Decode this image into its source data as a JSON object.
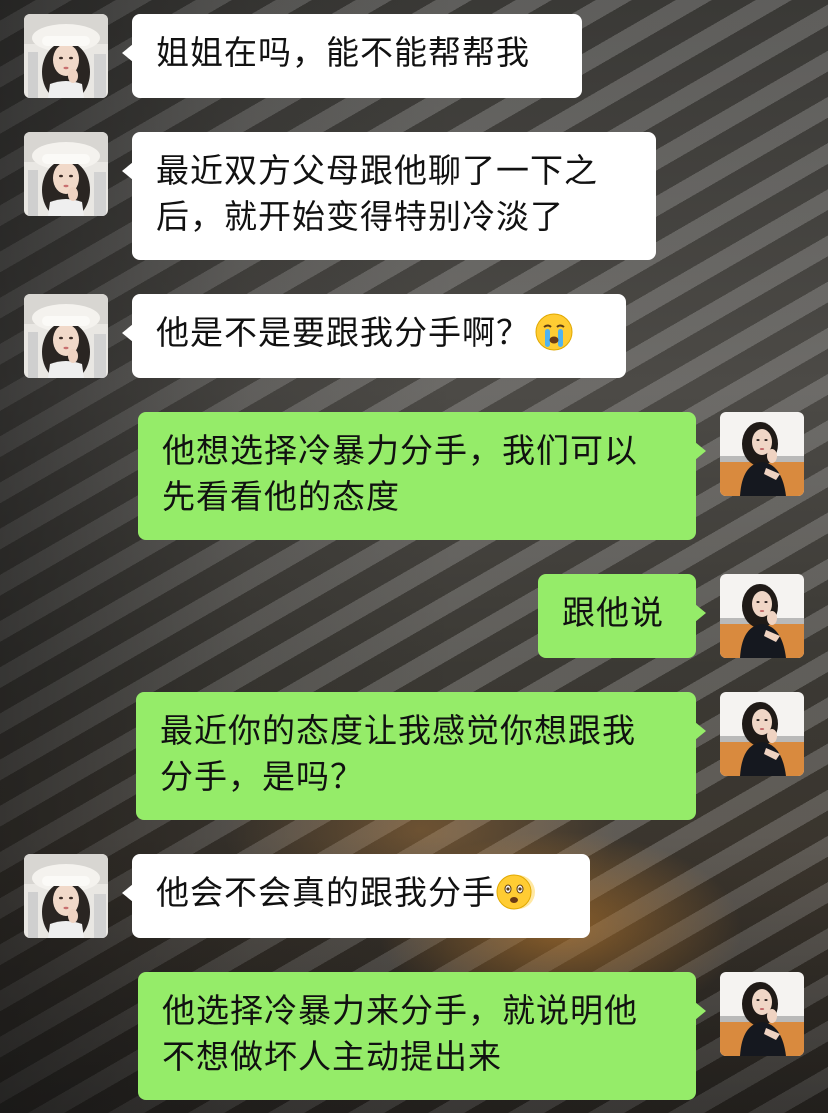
{
  "chat": {
    "messages": [
      {
        "side": "in",
        "text": "姐姐在吗，能不能帮帮我"
      },
      {
        "side": "in",
        "text_line1": "最近双方父母跟他聊了一下之",
        "text_line2": "后，就开始变得特别冷淡了"
      },
      {
        "side": "in",
        "text": "他是不是要跟我分手啊？",
        "emoji": "crying-face-icon"
      },
      {
        "side": "out",
        "text_line1": "他想选择冷暴力分手，我们可以",
        "text_line2": "先看看他的态度"
      },
      {
        "side": "out",
        "text": "跟他说"
      },
      {
        "side": "out",
        "text_line1": "最近你的态度让我感觉你想跟我",
        "text_line2": "分手，是吗？"
      },
      {
        "side": "in",
        "text": "他会不会真的跟我分手",
        "emoji": "shaking-face-icon"
      },
      {
        "side": "out",
        "text_line1": "他选择冷暴力来分手，就说明他",
        "text_line2": "不想做坏人主动提出来"
      }
    ]
  },
  "colors": {
    "incoming_bubble": "#ffffff",
    "outgoing_bubble": "#95ec69",
    "text": "#111111"
  }
}
